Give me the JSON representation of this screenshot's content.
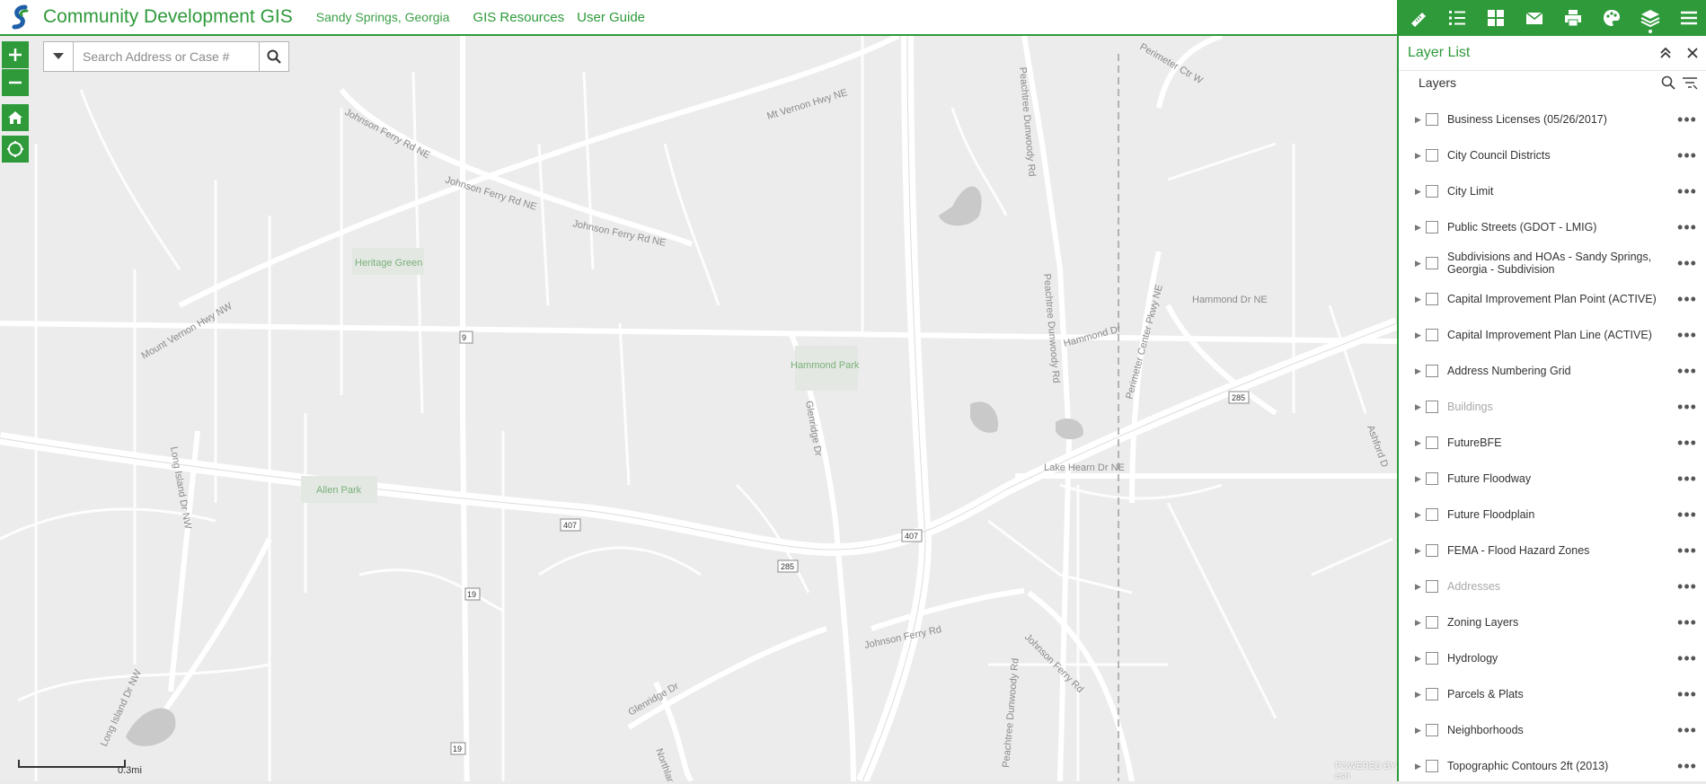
{
  "header": {
    "title": "Community Development GIS",
    "subtitle": "Sandy Springs, Georgia",
    "links": [
      "GIS Resources",
      "User Guide"
    ]
  },
  "search": {
    "placeholder": "Search Address or Case #"
  },
  "map": {
    "road_labels": [
      "Johnson Ferry Rd NE",
      "Johnson Ferry Rd NE",
      "Johnson Ferry Rd NE",
      "Mt Vernon Hwy NE",
      "Mount Vernon Hwy NW",
      "Long Island Dr NW",
      "Long Island Dr NW",
      "Glenridge Dr",
      "Glenridge Dr",
      "Northland Dr",
      "Peachtree Dunwoody Rd",
      "Peachtree Dunwoody Rd",
      "Peachtree Dunwoody Rd",
      "Johnson Ferry Rd",
      "Johnson Ferry Rd",
      "Hammond Dr",
      "Hammond Dr NE",
      "Perimeter Center Pkwy NE",
      "Perimeter Ctr W",
      "Lake Hearn Dr NE",
      "Ashford D"
    ],
    "park_labels": [
      "Heritage Green",
      "Hammond Park",
      "Allen Park"
    ],
    "route_shields": [
      "9",
      "407",
      "407",
      "285",
      "285",
      "19",
      "19"
    ],
    "scale_label": "0.3mi",
    "attribution": "POWERED BY esri"
  },
  "panel": {
    "title": "Layer List",
    "section_label": "Layers",
    "layers": [
      {
        "name": "Business Licenses (05/26/2017)",
        "dim": false
      },
      {
        "name": "City Council Districts",
        "dim": false
      },
      {
        "name": "City Limit",
        "dim": false
      },
      {
        "name": "Public Streets (GDOT - LMIG)",
        "dim": false
      },
      {
        "name": "Subdivisions and HOAs - Sandy Springs, Georgia - Subdivision",
        "dim": false
      },
      {
        "name": "Capital Improvement Plan Point (ACTIVE)",
        "dim": false
      },
      {
        "name": "Capital Improvement Plan Line (ACTIVE)",
        "dim": false
      },
      {
        "name": "Address Numbering Grid",
        "dim": false
      },
      {
        "name": "Buildings",
        "dim": true
      },
      {
        "name": "FutureBFE",
        "dim": false
      },
      {
        "name": "Future Floodway",
        "dim": false
      },
      {
        "name": "Future Floodplain",
        "dim": false
      },
      {
        "name": "FEMA - Flood Hazard Zones",
        "dim": false
      },
      {
        "name": "Addresses",
        "dim": true
      },
      {
        "name": "Zoning Layers",
        "dim": false
      },
      {
        "name": "Hydrology",
        "dim": false
      },
      {
        "name": "Parcels & Plats",
        "dim": false
      },
      {
        "name": "Neighborhoods",
        "dim": false
      },
      {
        "name": "Topographic Contours 2ft (2013)",
        "dim": false
      }
    ]
  },
  "colors": {
    "accent": "#2e9a3a",
    "map_background": "#ececec"
  },
  "icons": [
    "logo-icon",
    "plus-icon",
    "minus-icon",
    "home-icon",
    "locate-icon",
    "chevron-down-icon",
    "search-icon",
    "measure-icon",
    "list-icon",
    "grid-icon",
    "mail-icon",
    "print-icon",
    "palette-icon",
    "layers-icon",
    "menu-icon",
    "collapse-icon",
    "close-icon",
    "filter-icon",
    "caret-right-icon",
    "ellipsis-icon"
  ]
}
